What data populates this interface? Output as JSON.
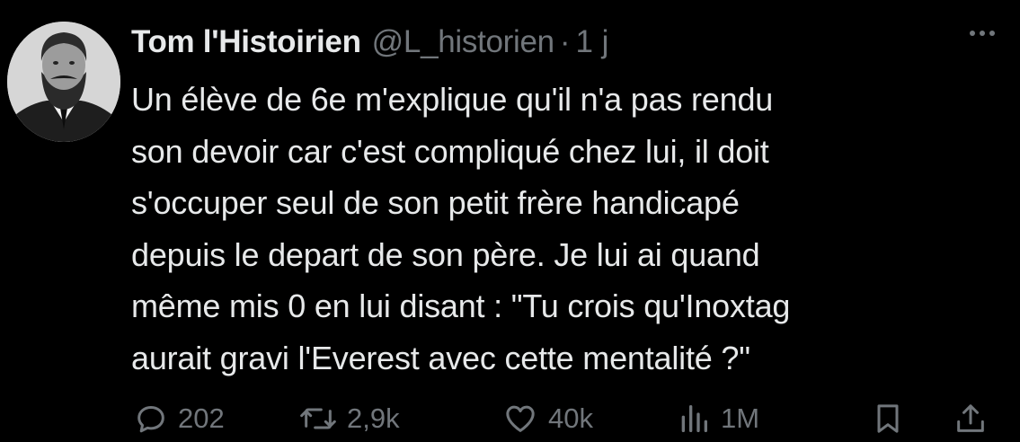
{
  "author": {
    "display_name": "Tom l'Histoirien",
    "handle": "@L_historien",
    "separator": "·",
    "time": "1 j"
  },
  "tweet": {
    "lines": [
      "Un élève de 6e m'explique qu'il n'a pas rendu",
      "son devoir car c'est compliqué chez lui, il doit",
      "s'occuper seul de son petit frère handicapé",
      "depuis le depart de son père. Je lui ai quand",
      "même mis 0 en lui disant : \"Tu crois qu'Inoxtag",
      "aurait gravi l'Everest avec cette mentalité ?\""
    ]
  },
  "actions": {
    "replies": "202",
    "reposts": "2,9k",
    "likes": "40k",
    "views": "1M"
  },
  "icons": {
    "more": "more-dots-icon",
    "reply": "reply-bubble-icon",
    "repost": "repost-arrows-icon",
    "like": "heart-icon",
    "views": "views-bars-icon",
    "bookmark": "bookmark-icon",
    "share": "share-upload-icon"
  },
  "colors": {
    "background": "#000000",
    "primary_text": "#e7e9ea",
    "secondary_text": "#71767b"
  }
}
